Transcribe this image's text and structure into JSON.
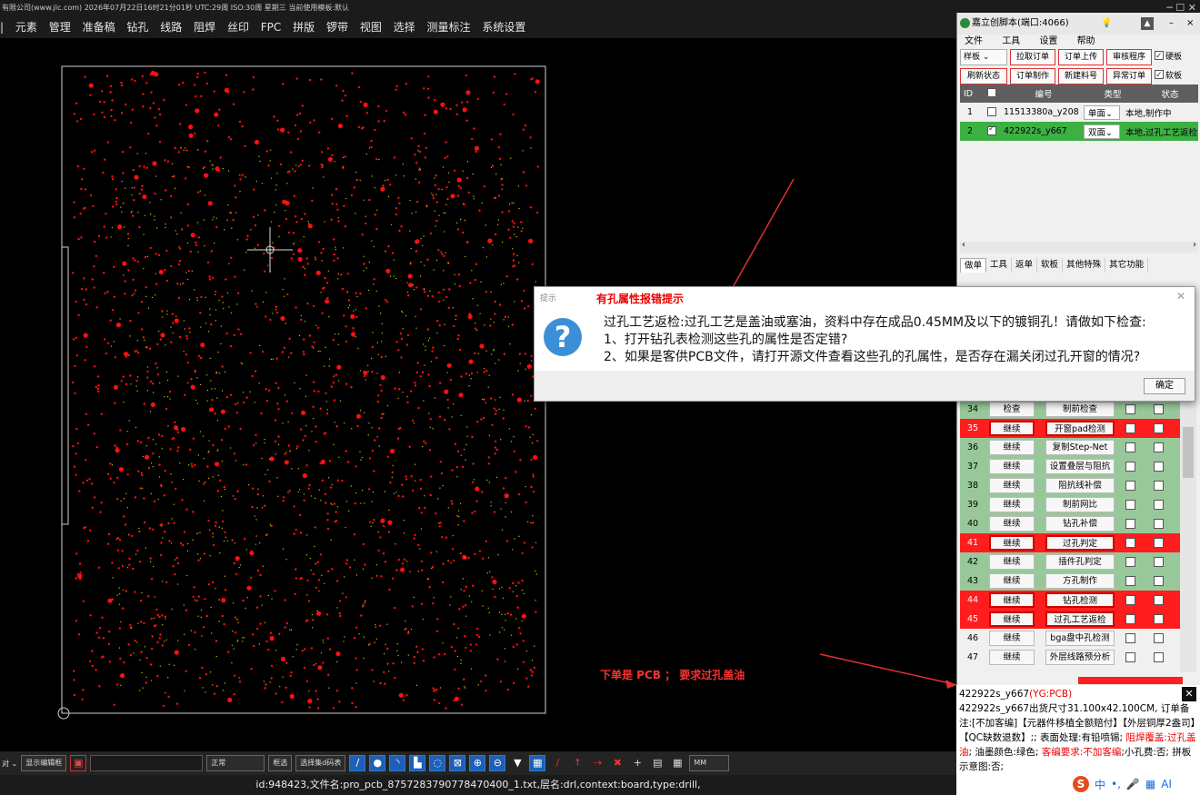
{
  "app": {
    "title_text": "有限公司(www.jlc.com)    2026年07月22日16时21分01秒  UTC:29周 ISO:30周  星期三    当前使用模板:默认",
    "window_controls": "─ ☐ ✕"
  },
  "menu": [
    "元素",
    "管理",
    "准备稿",
    "钻孔",
    "线路",
    "阻焊",
    "丝印",
    "FPC",
    "拼版",
    "锣带",
    "视图",
    "选择",
    "测量标注",
    "系统设置"
  ],
  "bottom_toolbar": {
    "show_editor": "显示编辑框",
    "mode": "正常",
    "frame_select": "框选",
    "select_set": "选择集d码表",
    "unit": "MM"
  },
  "status": "id:948423,文件名:pro_pcb_8757283790778470400_1.txt,层名:drl,context:board,type:drill,",
  "panel": {
    "title": "嘉立创脚本(端口:4066)",
    "menu": [
      "文件",
      "工具",
      "设置",
      "帮助"
    ],
    "buttons_row1": {
      "combo": "样板",
      "b1": "拉取订单",
      "b2": "订单上传",
      "b3": "审核程序",
      "chk": "硬板"
    },
    "buttons_row2": {
      "b0": "刷新状态",
      "b1": "订单制作",
      "b2": "新建料号",
      "b3": "异常订单",
      "chk": "软板"
    },
    "headers": [
      "ID",
      "编号",
      "类型",
      "状态"
    ],
    "rows": [
      {
        "id": "1",
        "code": "11513380a_y208",
        "type": "单面",
        "state": "本地,制作中"
      },
      {
        "id": "2",
        "code": "422922s_y667",
        "type": "双面",
        "state": "本地,过孔工艺返检"
      }
    ],
    "tabs": [
      "做单",
      "工具",
      "返单",
      "软板",
      "其他特殊",
      "其它功能"
    ]
  },
  "steps": [
    {
      "n": "34",
      "a": "检查",
      "b": "制前检查",
      "style": "g"
    },
    {
      "n": "35",
      "a": "继续",
      "b": "开窗pad检测",
      "style": "r"
    },
    {
      "n": "36",
      "a": "继续",
      "b": "复制Step-Net",
      "style": "g"
    },
    {
      "n": "37",
      "a": "继续",
      "b": "设置叠层与阻抗",
      "style": "g"
    },
    {
      "n": "38",
      "a": "继续",
      "b": "阻抗线补偿",
      "style": "g"
    },
    {
      "n": "39",
      "a": "继续",
      "b": "制前网比",
      "style": "g"
    },
    {
      "n": "40",
      "a": "继续",
      "b": "钻孔补偿",
      "style": "g"
    },
    {
      "n": "41",
      "a": "继续",
      "b": "过孔判定",
      "style": "r"
    },
    {
      "n": "42",
      "a": "继续",
      "b": "插件孔判定",
      "style": "g"
    },
    {
      "n": "43",
      "a": "继续",
      "b": "方孔制作",
      "style": "g"
    },
    {
      "n": "44",
      "a": "继续",
      "b": "钻孔检测",
      "style": "r"
    },
    {
      "n": "45",
      "a": "继续",
      "b": "过孔工艺返检",
      "style": "r"
    },
    {
      "n": "46",
      "a": "继续",
      "b": "bga盘中孔检测",
      "style": "w"
    },
    {
      "n": "47",
      "a": "继续",
      "b": "外层线路预分析",
      "style": "w"
    }
  ],
  "dialog": {
    "label": "提示",
    "title": "有孔属性报错提示",
    "line1": "过孔工艺返检:过孔工艺是盖油或塞油，资料中存在成品0.45MM及以下的镀铜孔！请做如下检查:",
    "line2": "1、打开钻孔表检测这些孔的属性是否定错?",
    "line3": "2、如果是客供PCB文件，请打开源文件查看这些孔的孔属性，是否存在漏关闭过孔开窗的情况?",
    "ok": "确定"
  },
  "annotation": "下单是 PCB ； 要求过孔盖油",
  "info": {
    "head_a": "422922s_y667",
    "head_b": "(YG:PCB)",
    "body1": "422922s_y667出货尺寸31.100x42.100CM, 订单备注:[不加客编]【元器件移植全额赔付】【外层铜厚2盎司】【QC缺数退数】;; 表面处理:有铅喷锡; ",
    "red1": "阻焊覆盖:过孔盖油",
    "body2": "; 油墨颜色:绿色; ",
    "red2": "客编要求:不加客编",
    "body3": ";小孔费:否; 拼板示意图:否;"
  },
  "ime": [
    "中",
    "•,",
    "🎤",
    "▦",
    "AI"
  ],
  "colors": {
    "pad": "#ff1010",
    "trace": "#c8c800",
    "step_red": "#ff1d1d",
    "step_green": "#98c89a",
    "selected": "#3cb043"
  }
}
